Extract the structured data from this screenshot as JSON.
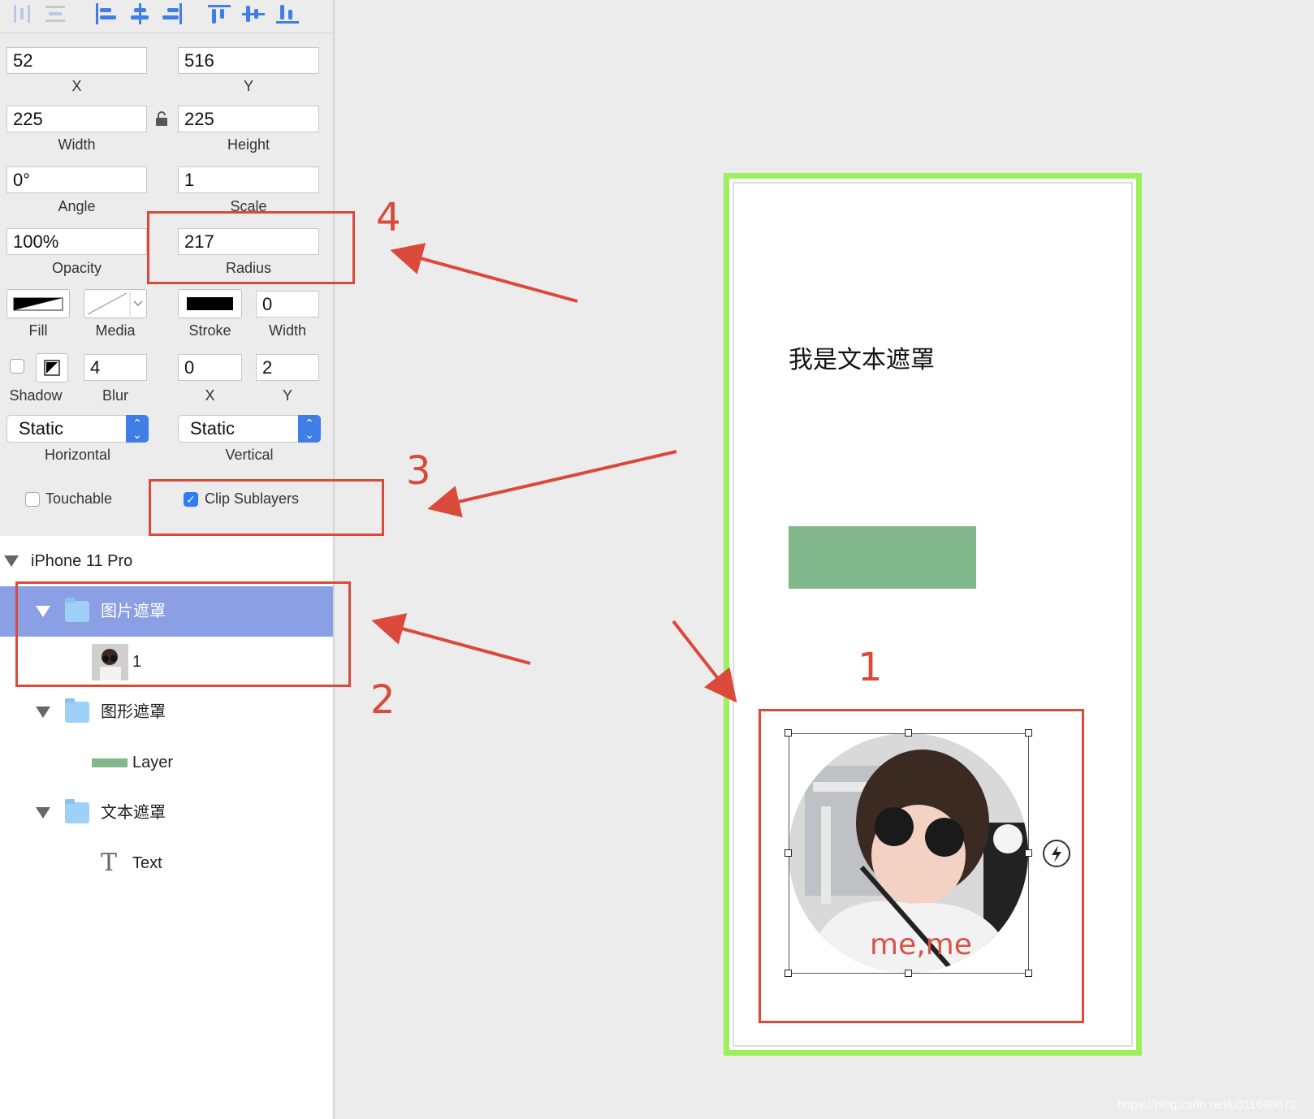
{
  "inspector": {
    "x": {
      "value": "52",
      "label": "X"
    },
    "y": {
      "value": "516",
      "label": "Y"
    },
    "width": {
      "value": "225",
      "label": "Width"
    },
    "height": {
      "value": "225",
      "label": "Height"
    },
    "angle": {
      "value": "0°",
      "label": "Angle"
    },
    "scale": {
      "value": "1",
      "label": "Scale"
    },
    "opacity": {
      "value": "100%",
      "label": "Opacity"
    },
    "radius": {
      "value": "217",
      "label": "Radius"
    },
    "fill_label": "Fill",
    "media_label": "Media",
    "stroke_label": "Stroke",
    "stroke_width": {
      "value": "0",
      "label": "Width"
    },
    "shadow_label": "Shadow",
    "blur": {
      "value": "4",
      "label": "Blur"
    },
    "shadow_x": {
      "value": "0",
      "label": "X"
    },
    "shadow_y": {
      "value": "2",
      "label": "Y"
    },
    "horizontal": {
      "value": "Static",
      "label": "Horizontal"
    },
    "vertical": {
      "value": "Static",
      "label": "Vertical"
    },
    "touchable": {
      "label": "Touchable",
      "checked": false
    },
    "clip_sublayers": {
      "label": "Clip Sublayers",
      "checked": true
    }
  },
  "layers": {
    "root": "iPhone 11 Pro",
    "items": [
      {
        "name": "图片遮罩",
        "selected": true
      },
      {
        "name": "1"
      },
      {
        "name": "图形遮罩"
      },
      {
        "name": "Layer"
      },
      {
        "name": "文本遮罩"
      },
      {
        "name": "Text"
      }
    ]
  },
  "canvas": {
    "text_mask": "我是文本遮罩",
    "green_rect_color": "#82b78b",
    "device_border_color": "#9df05d",
    "photo_caption": "me,me"
  },
  "annotations": [
    "1",
    "2",
    "3",
    "4"
  ],
  "watermark": "https://blog.csdn.net/u011608672",
  "colors": {
    "accent": "#2f7cf6",
    "selection": "#8a9fe4",
    "annotation": "#d94a3b"
  }
}
